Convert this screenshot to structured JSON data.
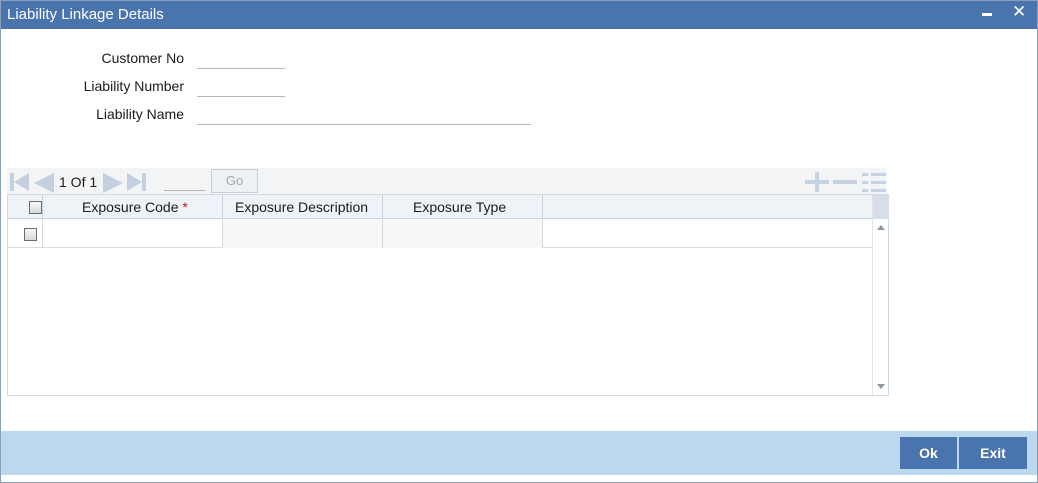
{
  "window": {
    "title": "Liability Linkage Details",
    "title_bar_color": "#4a74ad",
    "footer_color": "#bcd8ee"
  },
  "form": {
    "customer_no_label": "Customer No",
    "customer_no_value": "",
    "liability_number_label": "Liability Number",
    "liability_number_value": "",
    "liability_name_label": "Liability Name",
    "liability_name_value": ""
  },
  "pager": {
    "text": "1 Of 1",
    "page_input_value": "",
    "go_label": "Go"
  },
  "grid": {
    "columns": [
      {
        "label": "Exposure Code",
        "required": true
      },
      {
        "label": "Exposure Description",
        "required": false
      },
      {
        "label": "Exposure Type",
        "required": false
      }
    ],
    "required_marker": "*",
    "rows": [
      {
        "exposure_code": "",
        "exposure_description": "",
        "exposure_type": ""
      }
    ]
  },
  "footer": {
    "ok_label": "Ok",
    "exit_label": "Exit"
  },
  "icons": [
    "minimize-icon",
    "close-icon",
    "first-page-icon",
    "previous-page-icon",
    "next-page-icon",
    "last-page-icon",
    "add-row-icon",
    "delete-row-icon",
    "single-view-icon"
  ]
}
